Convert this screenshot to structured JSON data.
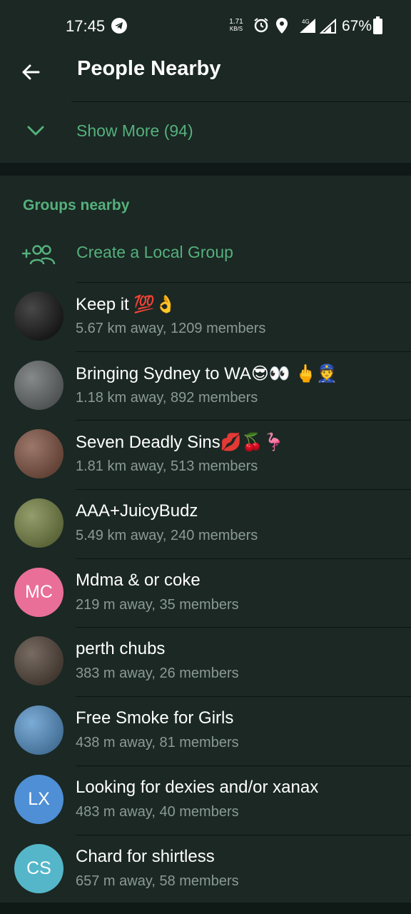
{
  "status_bar": {
    "time": "17:45",
    "speed_value": "1.71",
    "speed_unit": "KB/S",
    "network": "4G",
    "battery": "67%"
  },
  "appbar": {
    "title": "People Nearby"
  },
  "show_more": {
    "label": "Show More (94)"
  },
  "groups": {
    "header": "Groups nearby",
    "create_label": "Create a Local Group",
    "items": [
      {
        "name": "Keep it 💯👌",
        "sub": "5.67 km away, 1209 members",
        "avatar_type": "image",
        "avatar_color": "#0a0a0a"
      },
      {
        "name": "Bringing Sydney to WA😎👀 🖕👮",
        "sub": "1.18 km away, 892 members",
        "avatar_type": "image",
        "avatar_color": "#5d6262"
      },
      {
        "name": "Seven Deadly Sins💋🍒🦩",
        "sub": "1.81 km away, 513 members",
        "avatar_type": "image",
        "avatar_color": "#7a4a38"
      },
      {
        "name": "AAA+JuicyBudz",
        "sub": "5.49 km away, 240 members",
        "avatar_type": "image",
        "avatar_color": "#6f7d3a"
      },
      {
        "name": "Mdma & or coke",
        "sub": "219 m away, 35 members",
        "avatar_type": "initials",
        "initials": "MC",
        "avatar_color": "#e96f98"
      },
      {
        "name": "perth chubs",
        "sub": "383 m away, 26 members",
        "avatar_type": "image",
        "avatar_color": "#4a3a2e"
      },
      {
        "name": "Free Smoke for Girls",
        "sub": "438 m away, 81 members",
        "avatar_type": "image",
        "avatar_color": "#4f8fc8"
      },
      {
        "name": "Looking for dexies and/or xanax",
        "sub": "483 m away, 40 members",
        "avatar_type": "initials",
        "initials": "LX",
        "avatar_color": "#4f8fd6"
      },
      {
        "name": "Chard for shirtless",
        "sub": "657 m away, 58 members",
        "avatar_type": "initials",
        "initials": "CS",
        "avatar_color": "#55b6c9"
      }
    ]
  },
  "colors": {
    "accent": "#55b07c",
    "background": "#1b2824",
    "secondary_text": "#8a9a95"
  }
}
